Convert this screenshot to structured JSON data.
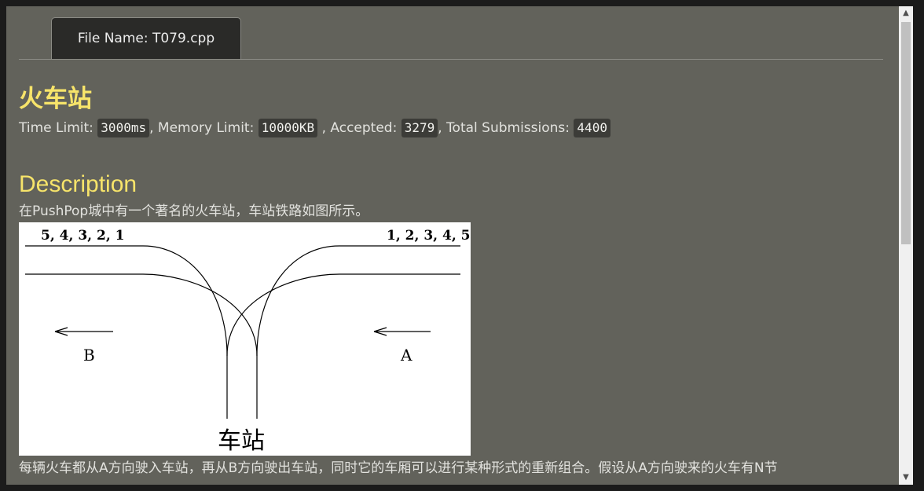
{
  "tab": {
    "label": "File Name:  T079.cpp"
  },
  "problem": {
    "title": "火车站",
    "time_label": "Time Limit:",
    "time_value": "3000ms",
    "memory_label": ", Memory Limit:",
    "memory_value": "10000KB",
    "accepted_label": ", Accepted:",
    "accepted_value": "3279",
    "submissions_label": ", Total Submissions:",
    "submissions_value": "4400"
  },
  "description": {
    "heading": "Description",
    "intro": "在PushPop城中有一个著名的火车站，车站铁路如图所示。",
    "detail": "每辆火车都从A方向驶入车站，再从B方向驶出车站，同时它的车厢可以进行某种形式的重新组合。假设从A方向驶来的火车有N节"
  },
  "figure": {
    "left_order": "5, 4, 3, 2, 1",
    "right_order": "1, 2, 3, 4, 5",
    "label_b": "B",
    "label_a": "A",
    "station": "车站"
  },
  "icons": {
    "scroll_up": "chevron-up-icon",
    "scroll_down": "chevron-down-icon"
  }
}
